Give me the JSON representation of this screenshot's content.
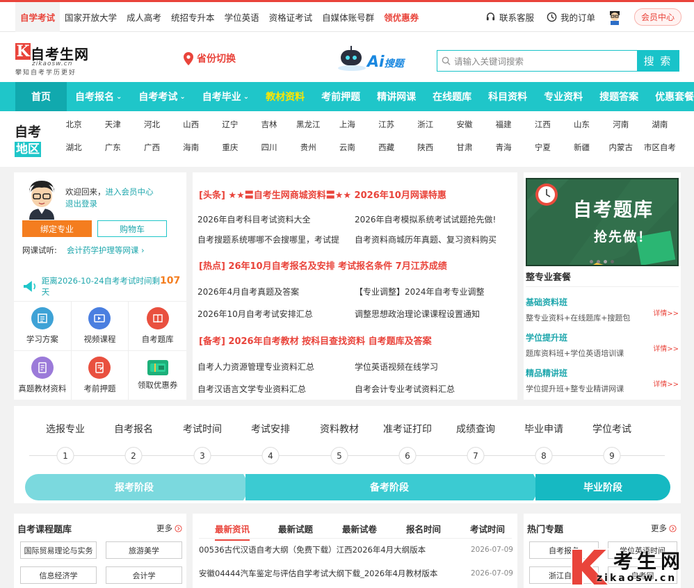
{
  "topbar": {
    "links": [
      "自学考试",
      "国家开放大学",
      "成人高考",
      "统招专升本",
      "学位英语",
      "资格证考试",
      "自媒体账号群",
      "领优惠券"
    ],
    "service": "联系客服",
    "orders": "我的订单",
    "vip": "会员中心"
  },
  "header": {
    "logo_name": "自考生网",
    "logo_domain": "zikaosw.cn",
    "logo_slogan": "攀知自考学历更好",
    "province": "省份切换",
    "ai_label": "Ai",
    "ai_suffix": "搜题",
    "search_placeholder": "请输入关键词搜索",
    "search_button": "搜 索"
  },
  "nav": [
    "首页",
    "自考报名",
    "自考考试",
    "自考毕业",
    "教材资料",
    "考前押题",
    "精讲网课",
    "在线题库",
    "科目资料",
    "专业资料",
    "搜题答案",
    "优惠套餐"
  ],
  "region": {
    "label_top": "自考",
    "label_bottom": "地区",
    "items": [
      "北京",
      "天津",
      "河北",
      "山西",
      "辽宁",
      "吉林",
      "黑龙江",
      "上海",
      "江苏",
      "浙江",
      "安徽",
      "福建",
      "江西",
      "山东",
      "河南",
      "湖南",
      "湖北",
      "广东",
      "广西",
      "海南",
      "重庆",
      "四川",
      "贵州",
      "云南",
      "西藏",
      "陕西",
      "甘肃",
      "青海",
      "宁夏",
      "新疆",
      "内蒙古",
      "市区自考"
    ]
  },
  "user": {
    "welcome": "欢迎回来，",
    "member_link": "进入会员中心",
    "logout": "退出登录",
    "bind": "绑定专业",
    "cart": "购物车",
    "trial_label": "网课试听:",
    "trial_value": "会计药学护理等网课",
    "countdown_prefix": "距离2026-10-24自考考试时间剩",
    "countdown_days": "107",
    "countdown_unit": "天",
    "icons": [
      "学习方案",
      "视频课程",
      "自考题库",
      "真题教材资料",
      "考前押题",
      "领取优惠券"
    ]
  },
  "news": {
    "s1": "[头条]  ★★〓自考生网商城资料〓★★   2026年10月网课特惠",
    "s1_links": [
      "2026年自考科目考试资料大全",
      "2026年自考模拟系统考试试题抢先做!",
      "自考搜题系统哪哪不会搜哪里，考试提",
      "自考资料商城历年真题、复习资料购买"
    ],
    "s2": "[热点]  26年10月自考报名及安排   考试报名条件   7月江苏成绩",
    "s2_links": [
      "2026年4月自考真题及答案",
      "【专业调整】2024年自考专业调整",
      "2026年10月自考考试安排汇总",
      "调整思想政治理论课课程设置通知"
    ],
    "s3": "[备考]  2026年自考教材   按科目查找资料   自考题库及答案",
    "s3_links": [
      "自考人力资源管理专业资料汇总",
      "学位英语视频在线学习",
      "自考汉语言文学专业资料汇总",
      "自考会计专业考试资料汇总"
    ]
  },
  "right": {
    "banner_title": "自考题库",
    "banner_sub": "抢先做！",
    "section_title": "整专业套餐",
    "packages": [
      {
        "name": "基础资料班",
        "desc": "整专业资料+在线题库+搜题包",
        "more": "详情>>"
      },
      {
        "name": "学位提升班",
        "desc": "题库资料班+学位英语培训课",
        "more": "详情>>"
      },
      {
        "name": "精品精讲班",
        "desc": "学位提升班+整专业精讲网课",
        "more": "详情>>"
      }
    ]
  },
  "steps": {
    "labels": [
      "选报专业",
      "自考报名",
      "考试时间",
      "考试安排",
      "资料教材",
      "准考证打印",
      "成绩查询",
      "毕业申请",
      "学位考试"
    ],
    "numbers": [
      "1",
      "2",
      "3",
      "4",
      "5",
      "6",
      "7",
      "8",
      "9"
    ],
    "phases": [
      "报考阶段",
      "备考阶段",
      "毕业阶段"
    ]
  },
  "bottom": {
    "course_title": "自考课程题库",
    "more": "更多",
    "courses": [
      "国际贸易理论与实务",
      "旅游美学",
      "信息经济学",
      "会计学"
    ],
    "tabs": [
      "最新资讯",
      "最新试题",
      "最新试卷",
      "报名时间",
      "考试时间"
    ],
    "rows": [
      {
        "title": "00536古代汉语自考大纲（免费下载）江西2026年4月大纲版本",
        "date": "2026-07-09"
      },
      {
        "title": "安徽04444汽车鉴定与评估自学考试大纲下载_2026年4月教材版本",
        "date": "2026-07-09"
      }
    ],
    "hot_title": "热门专题",
    "hot": [
      "自考报名",
      "学位英语时间",
      "浙江自考",
      "自考网"
    ]
  },
  "watermark": {
    "name": "考生网",
    "domain": "zikaosw.cn"
  },
  "colors": {
    "accent": "#e9443b",
    "teal": "#1fc6c9",
    "orange": "#f47d1f"
  }
}
